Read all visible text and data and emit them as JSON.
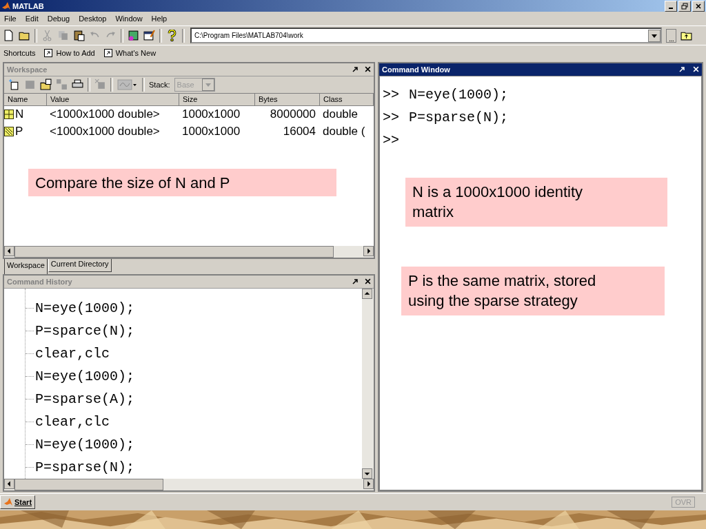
{
  "window": {
    "title": "MATLAB"
  },
  "menu": [
    "File",
    "Edit",
    "Debug",
    "Desktop",
    "Window",
    "Help"
  ],
  "current_directory": {
    "value": "C:\\Program Files\\MATLAB704\\work"
  },
  "shortcuts": [
    {
      "label": "Shortcuts",
      "kind": "plain"
    },
    {
      "label": "How to Add",
      "kind": "link"
    },
    {
      "label": "What's New",
      "kind": "link"
    }
  ],
  "workspace": {
    "title": "Workspace",
    "stack_label": "Stack:",
    "stack_value": "Base",
    "columns": [
      "Name",
      "Value",
      "Size",
      "Bytes",
      "Class"
    ],
    "rows": [
      {
        "kind": "full",
        "name": "N",
        "value": "<1000x1000 double>",
        "size": "1000x1000",
        "bytes": "8000000",
        "class": "double"
      },
      {
        "kind": "sparse",
        "name": "P",
        "value": "<1000x1000 double>",
        "size": "1000x1000",
        "bytes": "16004",
        "class": "double ("
      }
    ]
  },
  "tabs": [
    {
      "label": "Workspace",
      "selected": true
    },
    {
      "label": "Current Directory",
      "selected": false
    }
  ],
  "command_history": {
    "title": "Command History",
    "lines": [
      "N=eye(1000);",
      "P=sparce(N);",
      "clear,clc",
      "N=eye(1000);",
      "P=sparse(A);",
      "clear,clc",
      "N=eye(1000);",
      "P=sparse(N);"
    ]
  },
  "command_window": {
    "title": "Command Window",
    "lines": [
      {
        "prompt": ">>",
        "code": "N=eye(1000);"
      },
      {
        "prompt": ">>",
        "code": "P=sparse(N);"
      },
      {
        "prompt": ">>"
      }
    ]
  },
  "annotations": [
    {
      "text": "Compare the size of N and P"
    },
    {
      "text": "N is a 1000x1000 identity matrix"
    },
    {
      "text": "P is the same matrix, stored using the sparse strategy"
    }
  ],
  "start_button": "Start",
  "status": "OVR"
}
